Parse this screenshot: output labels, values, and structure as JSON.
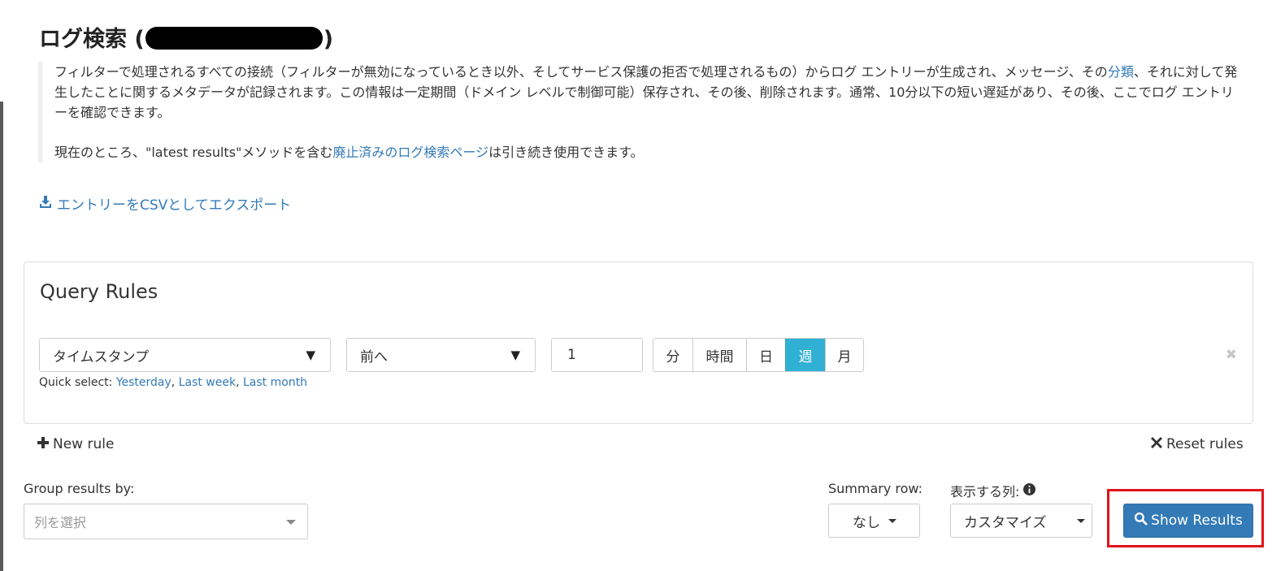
{
  "page": {
    "title_prefix": "ログ検索 (",
    "title_suffix": ")"
  },
  "intro": {
    "p1_a": "フィルターで処理されるすべての接続（フィルターが無効になっているとき以外、そしてサービス保護の拒否で処理されるもの）からログ エントリーが生成され、メッセージ、その",
    "p1_link": "分類",
    "p1_b": "、それに対して発生したことに関するメタデータが記録されます。この情報は一定期間（ドメイン レベルで制御可能）保存され、その後、削除されます。通常、10分以下の短い遅延があり、その後、ここでログ エントリーを確認できます。",
    "p2_a": "現在のところ、\"latest results\"メソッドを含む",
    "p2_link": "廃止済みのログ検索ページ",
    "p2_b": "は引き続き使用できます。"
  },
  "export": {
    "label": "エントリーをCSVとしてエクスポート"
  },
  "query_rules": {
    "title": "Query Rules",
    "rule": {
      "field": "タイムスタンプ",
      "operator": "前へ",
      "value": "1",
      "units": [
        "分",
        "時間",
        "日",
        "週",
        "月"
      ],
      "active_unit": "週"
    },
    "quick_select_label": "Quick select: ",
    "quick_select": [
      "Yesterday",
      "Last week",
      "Last month"
    ],
    "quick_sep": ", "
  },
  "actions": {
    "new_rule": "New rule",
    "reset_rules": "Reset rules"
  },
  "results": {
    "group_by_label": "Group results by:",
    "group_by_placeholder": "列を選択",
    "summary_row_label": "Summary row:",
    "summary_row_value": "なし",
    "columns_label": "表示する列:",
    "columns_value": "カスタマイズ",
    "show_results": "Show Results"
  },
  "colors": {
    "link": "#337ab7",
    "active_unit": "#31b0d5",
    "primary_button": "#337ab7",
    "highlight": "#e0131b"
  }
}
